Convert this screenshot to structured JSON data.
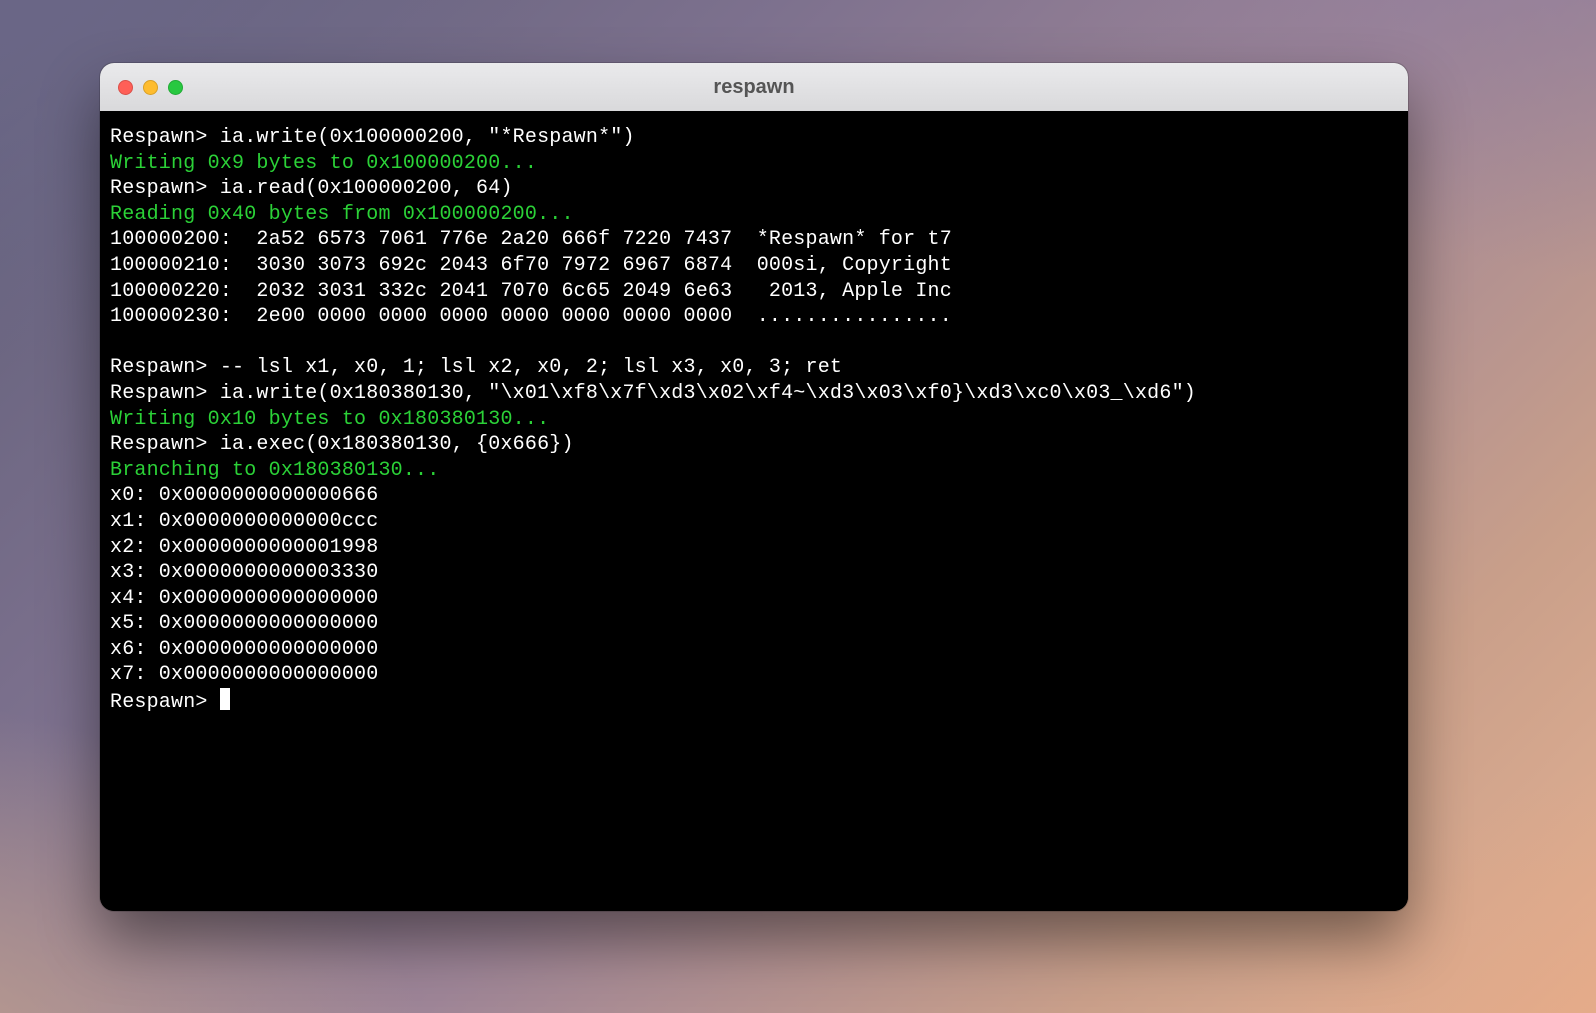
{
  "window": {
    "title": "respawn"
  },
  "colors": {
    "status": "#2bd137",
    "fg": "#ffffff",
    "bg": "#000000",
    "titlebar_text": "#555555",
    "traffic_close": "#ff5f57",
    "traffic_min": "#febc2e",
    "traffic_zoom": "#28c840"
  },
  "prompt": "Respawn> ",
  "lines": [
    {
      "type": "cmd",
      "text": "Respawn> ia.write(0x100000200, \"*Respawn*\")"
    },
    {
      "type": "status",
      "text": "Writing 0x9 bytes to 0x100000200..."
    },
    {
      "type": "cmd",
      "text": "Respawn> ia.read(0x100000200, 64)"
    },
    {
      "type": "status",
      "text": "Reading 0x40 bytes from 0x100000200..."
    },
    {
      "type": "out",
      "text": "100000200:  2a52 6573 7061 776e 2a20 666f 7220 7437  *Respawn* for t7"
    },
    {
      "type": "out",
      "text": "100000210:  3030 3073 692c 2043 6f70 7972 6967 6874  000si, Copyright"
    },
    {
      "type": "out",
      "text": "100000220:  2032 3031 332c 2041 7070 6c65 2049 6e63   2013, Apple Inc"
    },
    {
      "type": "out",
      "text": "100000230:  2e00 0000 0000 0000 0000 0000 0000 0000  ................"
    },
    {
      "type": "blank"
    },
    {
      "type": "cmd",
      "text": "Respawn> -- lsl x1, x0, 1; lsl x2, x0, 2; lsl x3, x0, 3; ret"
    },
    {
      "type": "cmd",
      "text": "Respawn> ia.write(0x180380130, \"\\x01\\xf8\\x7f\\xd3\\x02\\xf4~\\xd3\\x03\\xf0}\\xd3\\xc0\\x03_\\xd6\")"
    },
    {
      "type": "status",
      "text": "Writing 0x10 bytes to 0x180380130..."
    },
    {
      "type": "cmd",
      "text": "Respawn> ia.exec(0x180380130, {0x666})"
    },
    {
      "type": "status",
      "text": "Branching to 0x180380130..."
    },
    {
      "type": "out",
      "text": "x0: 0x0000000000000666"
    },
    {
      "type": "out",
      "text": "x1: 0x0000000000000ccc"
    },
    {
      "type": "out",
      "text": "x2: 0x0000000000001998"
    },
    {
      "type": "out",
      "text": "x3: 0x0000000000003330"
    },
    {
      "type": "out",
      "text": "x4: 0x0000000000000000"
    },
    {
      "type": "out",
      "text": "x5: 0x0000000000000000"
    },
    {
      "type": "out",
      "text": "x6: 0x0000000000000000"
    },
    {
      "type": "out",
      "text": "x7: 0x0000000000000000"
    },
    {
      "type": "prompt",
      "text": "Respawn> "
    }
  ]
}
